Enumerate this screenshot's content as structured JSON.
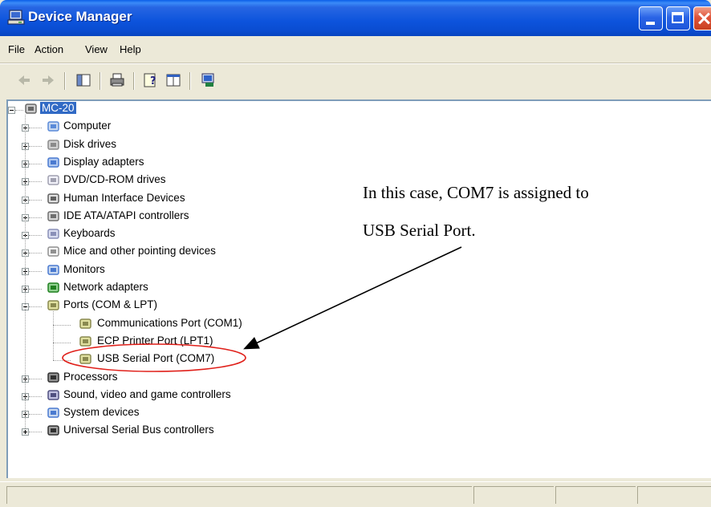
{
  "window": {
    "title": "Device Manager",
    "icon": "computer-monitor-icon"
  },
  "menu": {
    "file": "File",
    "action": "Action",
    "view": "View",
    "help": "Help"
  },
  "toolbar": {
    "buttons": [
      "back-arrow-icon",
      "forward-arrow-icon",
      "show-hide-console-tree-icon",
      "print-icon",
      "help-icon",
      "properties-icon",
      "scan-hardware-icon"
    ]
  },
  "tree": {
    "root": "MC-20",
    "items": [
      {
        "label": "Computer",
        "icon": "computer-icon"
      },
      {
        "label": "Disk drives",
        "icon": "disk-drive-icon"
      },
      {
        "label": "Display adapters",
        "icon": "display-adapter-icon"
      },
      {
        "label": "DVD/CD-ROM drives",
        "icon": "cd-drive-icon"
      },
      {
        "label": "Human Interface Devices",
        "icon": "hid-icon"
      },
      {
        "label": "IDE ATA/ATAPI controllers",
        "icon": "ide-controller-icon"
      },
      {
        "label": "Keyboards",
        "icon": "keyboard-icon"
      },
      {
        "label": "Mice and other pointing devices",
        "icon": "mouse-icon"
      },
      {
        "label": "Monitors",
        "icon": "monitor-icon"
      },
      {
        "label": "Network adapters",
        "icon": "network-adapter-icon"
      },
      {
        "label": "Ports (COM & LPT)",
        "icon": "port-icon",
        "expanded": true,
        "children": [
          "Communications Port (COM1)",
          "ECP Printer Port (LPT1)",
          "USB Serial Port (COM7)"
        ]
      },
      {
        "label": "Processors",
        "icon": "processor-icon"
      },
      {
        "label": "Sound, video and game controllers",
        "icon": "sound-icon"
      },
      {
        "label": "System devices",
        "icon": "system-device-icon"
      },
      {
        "label": "Universal Serial Bus controllers",
        "icon": "usb-icon"
      }
    ]
  },
  "annotation": {
    "line1": "In this case, COM7 is assigned to",
    "line2": "USB Serial Port."
  },
  "colors": {
    "titlebar": "#0a4cd0",
    "selection": "#316ac5",
    "highlight_ellipse": "#e0201a"
  }
}
